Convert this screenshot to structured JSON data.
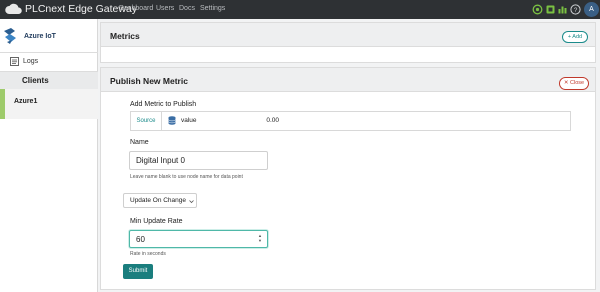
{
  "app": {
    "title": "PLCnext Edge Gateway",
    "nav": [
      "Dashboard",
      "Users",
      "Docs",
      "Settings"
    ],
    "user_initial": "A",
    "colors": {
      "topbar": "#2e3134",
      "accent": "#1b8b8b",
      "danger": "#c0392b",
      "client_marker": "#9ecb6b"
    }
  },
  "sidebar": {
    "title": "Azure IoT",
    "logs_label": "Logs",
    "clients_header": "Clients",
    "clients": [
      "Azure1"
    ]
  },
  "metrics_panel": {
    "title": "Metrics",
    "add_label": "+ Add"
  },
  "publish_panel": {
    "title": "Publish New Metric",
    "close_label": "Close",
    "add_metric_label": "Add Metric to Publish",
    "source_tab": "Source",
    "source_value": "value",
    "source_number": "0.00",
    "name_label": "Name",
    "name_value": "Digital Input 0",
    "name_hint": "Leave name blank to use node name for data point",
    "update_mode": "Update On Change",
    "min_rate_label": "Min Update Rate",
    "min_rate_value": "60",
    "min_rate_hint": "Rate in seconds",
    "submit_label": "Submit"
  }
}
